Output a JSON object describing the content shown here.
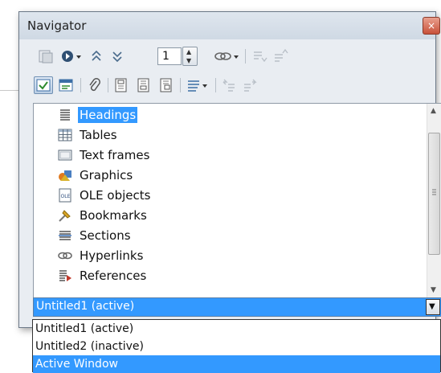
{
  "window": {
    "title": "Navigator",
    "close_glyph": "×"
  },
  "toolbar": {
    "page_number": "1"
  },
  "content_list": {
    "items": [
      {
        "label": "Headings",
        "icon": "headings-icon",
        "selected": true
      },
      {
        "label": "Tables",
        "icon": "tables-icon"
      },
      {
        "label": "Text frames",
        "icon": "text-frames-icon"
      },
      {
        "label": "Graphics",
        "icon": "graphics-icon"
      },
      {
        "label": "OLE objects",
        "icon": "ole-objects-icon"
      },
      {
        "label": "Bookmarks",
        "icon": "bookmarks-icon"
      },
      {
        "label": "Sections",
        "icon": "sections-icon"
      },
      {
        "label": "Hyperlinks",
        "icon": "hyperlinks-icon"
      },
      {
        "label": "References",
        "icon": "references-icon"
      }
    ]
  },
  "document_select": {
    "selected": "Untitled1 (active)",
    "options": [
      "Untitled1 (active)",
      "Untitled2 (inactive)",
      "Active Window"
    ],
    "highlighted_option": "Active Window"
  },
  "colors": {
    "selection": "#3399ff",
    "window_bg": "#e9edf2"
  }
}
